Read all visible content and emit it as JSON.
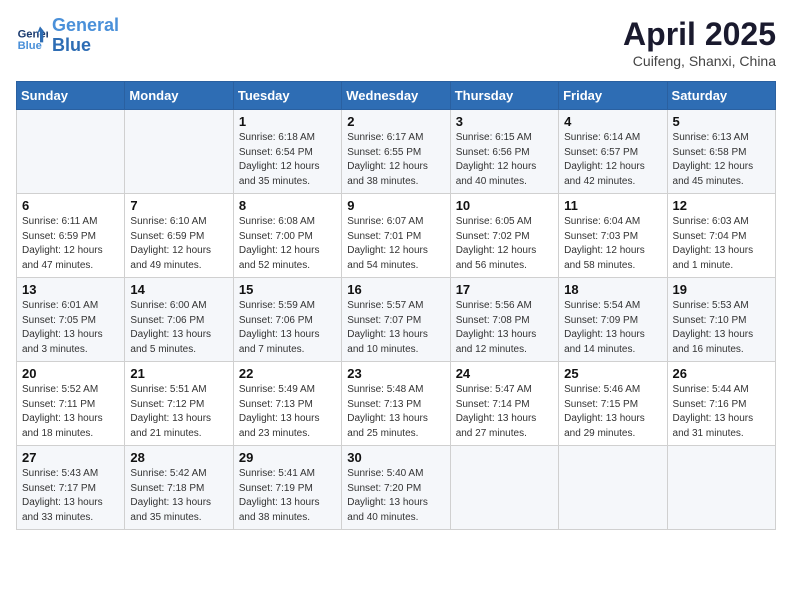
{
  "header": {
    "logo_line1": "General",
    "logo_line2": "Blue",
    "title": "April 2025",
    "location": "Cuifeng, Shanxi, China"
  },
  "weekdays": [
    "Sunday",
    "Monday",
    "Tuesday",
    "Wednesday",
    "Thursday",
    "Friday",
    "Saturday"
  ],
  "weeks": [
    [
      {
        "day": "",
        "info": ""
      },
      {
        "day": "",
        "info": ""
      },
      {
        "day": "1",
        "info": "Sunrise: 6:18 AM\nSunset: 6:54 PM\nDaylight: 12 hours and 35 minutes."
      },
      {
        "day": "2",
        "info": "Sunrise: 6:17 AM\nSunset: 6:55 PM\nDaylight: 12 hours and 38 minutes."
      },
      {
        "day": "3",
        "info": "Sunrise: 6:15 AM\nSunset: 6:56 PM\nDaylight: 12 hours and 40 minutes."
      },
      {
        "day": "4",
        "info": "Sunrise: 6:14 AM\nSunset: 6:57 PM\nDaylight: 12 hours and 42 minutes."
      },
      {
        "day": "5",
        "info": "Sunrise: 6:13 AM\nSunset: 6:58 PM\nDaylight: 12 hours and 45 minutes."
      }
    ],
    [
      {
        "day": "6",
        "info": "Sunrise: 6:11 AM\nSunset: 6:59 PM\nDaylight: 12 hours and 47 minutes."
      },
      {
        "day": "7",
        "info": "Sunrise: 6:10 AM\nSunset: 6:59 PM\nDaylight: 12 hours and 49 minutes."
      },
      {
        "day": "8",
        "info": "Sunrise: 6:08 AM\nSunset: 7:00 PM\nDaylight: 12 hours and 52 minutes."
      },
      {
        "day": "9",
        "info": "Sunrise: 6:07 AM\nSunset: 7:01 PM\nDaylight: 12 hours and 54 minutes."
      },
      {
        "day": "10",
        "info": "Sunrise: 6:05 AM\nSunset: 7:02 PM\nDaylight: 12 hours and 56 minutes."
      },
      {
        "day": "11",
        "info": "Sunrise: 6:04 AM\nSunset: 7:03 PM\nDaylight: 12 hours and 58 minutes."
      },
      {
        "day": "12",
        "info": "Sunrise: 6:03 AM\nSunset: 7:04 PM\nDaylight: 13 hours and 1 minute."
      }
    ],
    [
      {
        "day": "13",
        "info": "Sunrise: 6:01 AM\nSunset: 7:05 PM\nDaylight: 13 hours and 3 minutes."
      },
      {
        "day": "14",
        "info": "Sunrise: 6:00 AM\nSunset: 7:06 PM\nDaylight: 13 hours and 5 minutes."
      },
      {
        "day": "15",
        "info": "Sunrise: 5:59 AM\nSunset: 7:06 PM\nDaylight: 13 hours and 7 minutes."
      },
      {
        "day": "16",
        "info": "Sunrise: 5:57 AM\nSunset: 7:07 PM\nDaylight: 13 hours and 10 minutes."
      },
      {
        "day": "17",
        "info": "Sunrise: 5:56 AM\nSunset: 7:08 PM\nDaylight: 13 hours and 12 minutes."
      },
      {
        "day": "18",
        "info": "Sunrise: 5:54 AM\nSunset: 7:09 PM\nDaylight: 13 hours and 14 minutes."
      },
      {
        "day": "19",
        "info": "Sunrise: 5:53 AM\nSunset: 7:10 PM\nDaylight: 13 hours and 16 minutes."
      }
    ],
    [
      {
        "day": "20",
        "info": "Sunrise: 5:52 AM\nSunset: 7:11 PM\nDaylight: 13 hours and 18 minutes."
      },
      {
        "day": "21",
        "info": "Sunrise: 5:51 AM\nSunset: 7:12 PM\nDaylight: 13 hours and 21 minutes."
      },
      {
        "day": "22",
        "info": "Sunrise: 5:49 AM\nSunset: 7:13 PM\nDaylight: 13 hours and 23 minutes."
      },
      {
        "day": "23",
        "info": "Sunrise: 5:48 AM\nSunset: 7:13 PM\nDaylight: 13 hours and 25 minutes."
      },
      {
        "day": "24",
        "info": "Sunrise: 5:47 AM\nSunset: 7:14 PM\nDaylight: 13 hours and 27 minutes."
      },
      {
        "day": "25",
        "info": "Sunrise: 5:46 AM\nSunset: 7:15 PM\nDaylight: 13 hours and 29 minutes."
      },
      {
        "day": "26",
        "info": "Sunrise: 5:44 AM\nSunset: 7:16 PM\nDaylight: 13 hours and 31 minutes."
      }
    ],
    [
      {
        "day": "27",
        "info": "Sunrise: 5:43 AM\nSunset: 7:17 PM\nDaylight: 13 hours and 33 minutes."
      },
      {
        "day": "28",
        "info": "Sunrise: 5:42 AM\nSunset: 7:18 PM\nDaylight: 13 hours and 35 minutes."
      },
      {
        "day": "29",
        "info": "Sunrise: 5:41 AM\nSunset: 7:19 PM\nDaylight: 13 hours and 38 minutes."
      },
      {
        "day": "30",
        "info": "Sunrise: 5:40 AM\nSunset: 7:20 PM\nDaylight: 13 hours and 40 minutes."
      },
      {
        "day": "",
        "info": ""
      },
      {
        "day": "",
        "info": ""
      },
      {
        "day": "",
        "info": ""
      }
    ]
  ]
}
